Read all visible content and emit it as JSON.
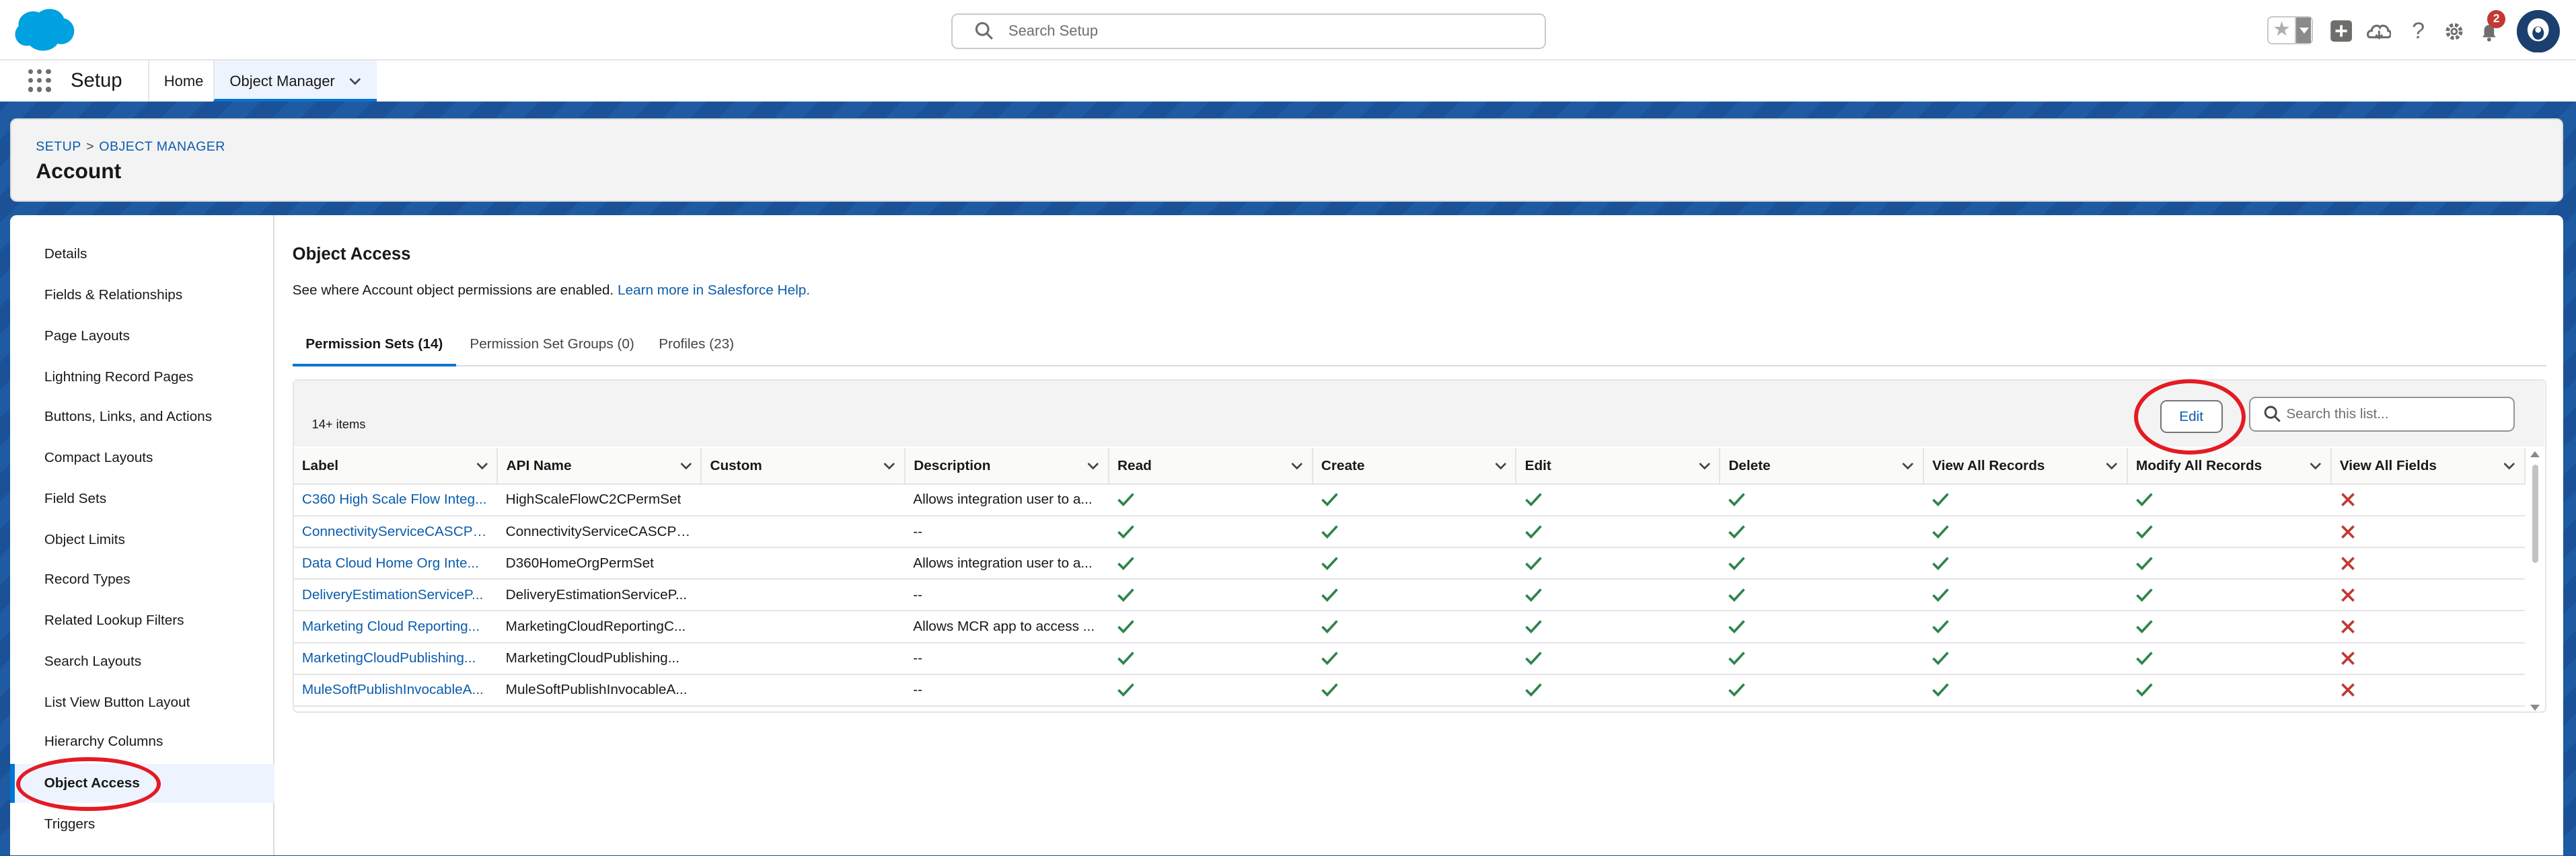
{
  "header": {
    "search_placeholder": "Search Setup",
    "notification_count": "2"
  },
  "nav": {
    "app_name": "Setup",
    "tabs": [
      {
        "label": "Home"
      },
      {
        "label": "Object Manager"
      }
    ]
  },
  "page": {
    "breadcrumb": [
      "SETUP",
      "OBJECT MANAGER"
    ],
    "breadcrumb_sep": ">",
    "title": "Account"
  },
  "sidebar": {
    "items": [
      {
        "label": "Details"
      },
      {
        "label": "Fields & Relationships"
      },
      {
        "label": "Page Layouts"
      },
      {
        "label": "Lightning Record Pages"
      },
      {
        "label": "Buttons, Links, and Actions"
      },
      {
        "label": "Compact Layouts"
      },
      {
        "label": "Field Sets"
      },
      {
        "label": "Object Limits"
      },
      {
        "label": "Record Types"
      },
      {
        "label": "Related Lookup Filters"
      },
      {
        "label": "Search Layouts"
      },
      {
        "label": "List View Button Layout"
      },
      {
        "label": "Hierarchy Columns"
      },
      {
        "label": "Object Access"
      },
      {
        "label": "Triggers"
      }
    ],
    "active": "Object Access"
  },
  "main": {
    "title": "Object Access",
    "description": "See where Account object permissions are enabled.",
    "help_link": "Learn more in Salesforce Help.",
    "tabs": [
      {
        "label": "Permission Sets (14)"
      },
      {
        "label": "Permission Set Groups (0)"
      },
      {
        "label": "Profiles (23)"
      }
    ],
    "item_count": "14+ items",
    "edit_label": "Edit",
    "list_search_placeholder": "Search this list...",
    "columns": [
      "Label",
      "API Name",
      "Custom",
      "Description",
      "Read",
      "Create",
      "Edit",
      "Delete",
      "View All Records",
      "Modify All Records",
      "View All Fields"
    ],
    "rows": [
      {
        "label": "C360 High Scale Flow Integ...",
        "api": "HighScaleFlowC2CPermSet",
        "custom": "",
        "desc": "Allows integration user to a...",
        "read": true,
        "create": true,
        "edit": true,
        "delete": true,
        "var": true,
        "mar": true,
        "vaf": false
      },
      {
        "label": "ConnectivityServiceCASCPe...",
        "api": "ConnectivityServiceCASCPe...",
        "custom": "",
        "desc": "--",
        "read": true,
        "create": true,
        "edit": true,
        "delete": true,
        "var": true,
        "mar": true,
        "vaf": false
      },
      {
        "label": "Data Cloud Home Org Inte...",
        "api": "D360HomeOrgPermSet",
        "custom": "",
        "desc": "Allows integration user to a...",
        "read": true,
        "create": true,
        "edit": true,
        "delete": true,
        "var": true,
        "mar": true,
        "vaf": false
      },
      {
        "label": "DeliveryEstimationServiceP...",
        "api": "DeliveryEstimationServiceP...",
        "custom": "",
        "desc": "--",
        "read": true,
        "create": true,
        "edit": true,
        "delete": true,
        "var": true,
        "mar": true,
        "vaf": false
      },
      {
        "label": "Marketing Cloud Reporting...",
        "api": "MarketingCloudReportingC...",
        "custom": "",
        "desc": "Allows MCR app to access ...",
        "read": true,
        "create": true,
        "edit": true,
        "delete": true,
        "var": true,
        "mar": true,
        "vaf": false
      },
      {
        "label": "MarketingCloudPublishing...",
        "api": "MarketingCloudPublishing...",
        "custom": "",
        "desc": "--",
        "read": true,
        "create": true,
        "edit": true,
        "delete": true,
        "var": true,
        "mar": true,
        "vaf": false
      },
      {
        "label": "MuleSoftPublishInvocableA...",
        "api": "MuleSoftPublishInvocableA...",
        "custom": "",
        "desc": "--",
        "read": true,
        "create": true,
        "edit": true,
        "delete": true,
        "var": true,
        "mar": true,
        "vaf": false
      }
    ]
  },
  "colors": {
    "brand": "#0176d3",
    "link": "#0b5cab",
    "check": "#2e844a",
    "cross": "#c23934",
    "annotation": "#e41b23"
  }
}
